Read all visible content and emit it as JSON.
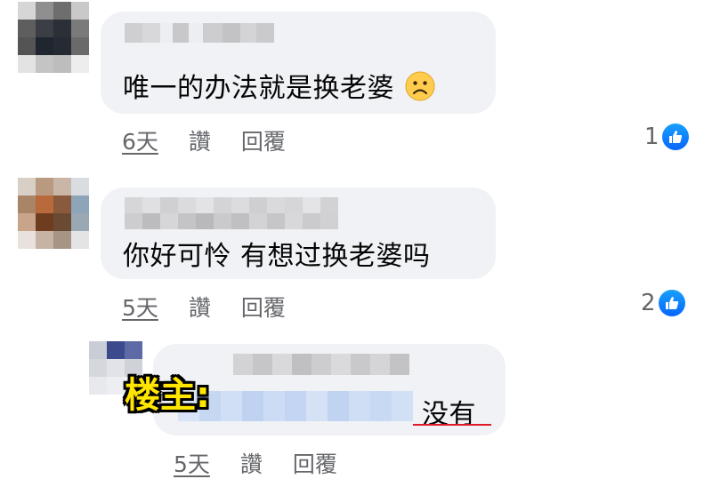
{
  "comments": [
    {
      "text": "唯一的办法就是换老婆",
      "time": "6天",
      "like": "讚",
      "reply": "回覆",
      "reaction_count": "1",
      "emoji": "frowning-face-icon"
    },
    {
      "text": "你好可怜 有想过换老婆吗",
      "time": "5天",
      "like": "讚",
      "reply": "回覆",
      "reaction_count": "2"
    }
  ],
  "reply": {
    "label": "楼主:",
    "text": "没有",
    "time": "5天",
    "like": "讚",
    "reply": "回覆"
  },
  "colors": {
    "bubble": "#f0f2f5",
    "like_blue": "#0866ff",
    "meta_gray": "#65676b",
    "label_yellow": "#ffe600",
    "underline_red": "#e0192b"
  }
}
